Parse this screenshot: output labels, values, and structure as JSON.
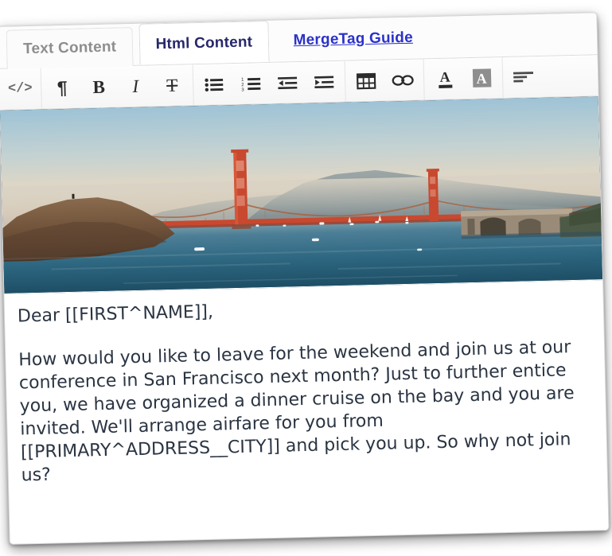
{
  "tabs": [
    {
      "label": "Text Content",
      "state": "inactive",
      "name": "tab-text-content"
    },
    {
      "label": "Html Content",
      "state": "active",
      "name": "tab-html-content"
    },
    {
      "label": "MergeTag Guide",
      "state": "link",
      "name": "link-mergetag-guide"
    }
  ],
  "toolbar": {
    "groups": [
      {
        "buttons": [
          {
            "name": "source-code-button",
            "glyph": "</>",
            "title": "Source code"
          }
        ]
      },
      {
        "buttons": [
          {
            "name": "paragraph-button",
            "glyph": "¶",
            "title": "Paragraph"
          },
          {
            "name": "bold-button",
            "glyph": "B",
            "title": "Bold"
          },
          {
            "name": "italic-button",
            "glyph": "I",
            "title": "Italic"
          },
          {
            "name": "strikethrough-button",
            "glyph": "T",
            "title": "Strikethrough"
          }
        ]
      },
      {
        "buttons": [
          {
            "name": "bullet-list-button",
            "glyph": "",
            "title": "Bulleted list"
          },
          {
            "name": "numbered-list-button",
            "glyph": "",
            "title": "Numbered list"
          },
          {
            "name": "outdent-button",
            "glyph": "",
            "title": "Decrease indent"
          },
          {
            "name": "indent-button",
            "glyph": "",
            "title": "Increase indent"
          }
        ]
      },
      {
        "buttons": [
          {
            "name": "insert-table-button",
            "glyph": "",
            "title": "Insert table"
          },
          {
            "name": "insert-link-button",
            "glyph": "",
            "title": "Insert link"
          }
        ]
      },
      {
        "buttons": [
          {
            "name": "font-color-button",
            "glyph": "A",
            "title": "Text color"
          },
          {
            "name": "highlight-color-button",
            "glyph": "A",
            "title": "Background color"
          }
        ]
      },
      {
        "buttons": [
          {
            "name": "align-left-button",
            "glyph": "",
            "title": "Align left"
          }
        ]
      }
    ]
  },
  "hero_image": {
    "name": "golden-gate-bridge-image",
    "alt": "Golden Gate Bridge over San Francisco Bay at dusk"
  },
  "content": {
    "greeting": "Dear [[FIRST^NAME]],",
    "body": "How would you like to leave  for the weekend and join us at our conference in San Francisco next month? Just to further entice you, we have organized a dinner cruise on the bay and you are invited. We'll arrange airfare for you from [[PRIMARY^ADDRESS__CITY]] and pick you up. So why not join us?"
  },
  "colors": {
    "active_tab_text": "#27286b",
    "inactive_tab_text": "#8e8e8e",
    "link_text": "#2b31c9",
    "body_text": "#2a3442",
    "bridge_red": "#c8492f"
  }
}
